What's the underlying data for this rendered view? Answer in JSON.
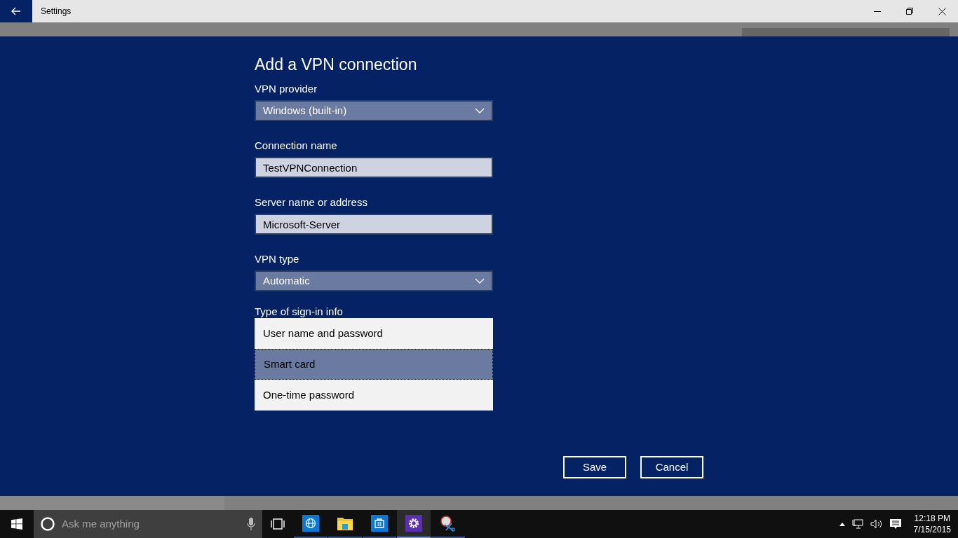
{
  "window": {
    "title": "Settings"
  },
  "dialog": {
    "title": "Add a VPN connection",
    "fields": [
      {
        "label": "VPN provider",
        "kind": "dropdown",
        "value": "Windows (built-in)"
      },
      {
        "label": "Connection name",
        "kind": "text",
        "value": "TestVPNConnection"
      },
      {
        "label": "Server name or address",
        "kind": "text",
        "value": "Microsoft-Server"
      },
      {
        "label": "VPN type",
        "kind": "dropdown",
        "value": "Automatic"
      }
    ],
    "signin": {
      "label": "Type of sign-in info",
      "options": [
        {
          "label": "User name and password",
          "selected": false
        },
        {
          "label": "Smart card",
          "selected": true
        },
        {
          "label": "One-time password",
          "selected": false
        }
      ]
    },
    "buttons": [
      "Save",
      "Cancel"
    ]
  },
  "taskbar": {
    "search_placeholder": "Ask me anything",
    "apps": [
      {
        "kind": "browser",
        "active": false
      },
      {
        "kind": "explorer",
        "active": false
      },
      {
        "kind": "store",
        "active": false
      },
      {
        "kind": "settings",
        "active": true
      },
      {
        "kind": "snipping",
        "active": false
      }
    ],
    "time": "12:18 PM",
    "date": "7/15/2015"
  }
}
